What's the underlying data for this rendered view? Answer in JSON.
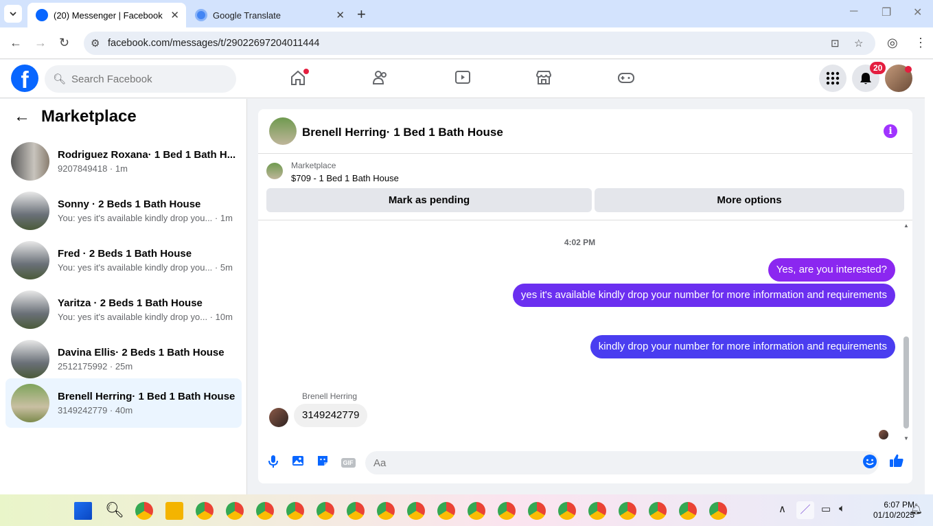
{
  "browser": {
    "tabs": [
      {
        "title": "(20) Messenger | Facebook",
        "close": "✕"
      },
      {
        "title": "Google Translate",
        "close": "✕"
      }
    ],
    "new_tab": "+",
    "url": "facebook.com/messages/t/29022697204011444",
    "window": {
      "minimize": "─",
      "maximize": "❐",
      "close": "✕"
    }
  },
  "facebook": {
    "logo": "f",
    "search_placeholder": "Search Facebook",
    "notifications_count": "20",
    "colors": {
      "brand": "#0866ff",
      "outgoing": "#4a3df0",
      "incoming": "#f0f0f0",
      "badge": "#e41e3f",
      "selected": "#ebf5ff",
      "info": "#a033ff"
    }
  },
  "sidebar": {
    "title": "Marketplace",
    "conversations": [
      {
        "name": "Rodriguez Roxana· 1 Bed 1 Bath H...",
        "preview": "9207849418 · 1m"
      },
      {
        "name": "Sonny · 2 Beds 1 Bath House",
        "preview": "You: yes it's available kindly drop you... · 1m"
      },
      {
        "name": "Fred · 2 Beds 1 Bath House",
        "preview": "You: yes it's available kindly drop you... · 5m"
      },
      {
        "name": "Yaritza · 2 Beds 1 Bath House",
        "preview": "You: yes it's available kindly drop yo... · 10m"
      },
      {
        "name": "Davina Ellis· 2 Beds 1 Bath House",
        "preview": "2512175992 · 25m"
      },
      {
        "name": "Brenell Herring· 1 Bed 1 Bath House",
        "preview": "3149242779 · 40m"
      }
    ]
  },
  "chat": {
    "title": "Brenell Herring· 1 Bed 1 Bath House",
    "info_icon": "i",
    "marketplace_label": "Marketplace",
    "listing": "$709 - 1 Bed 1 Bath House",
    "mark_pending": "Mark as pending",
    "more_options": "More options",
    "timestamp": "4:02 PM",
    "outgoing": [
      "Yes, are you interested?",
      "yes it's available kindly drop your number for more information and requirements",
      "kindly drop your number for more information and requirements"
    ],
    "incoming_sender": "Brenell Herring",
    "incoming_message": "3149242779",
    "composer_placeholder": "Aa",
    "gif_label": "GIF"
  },
  "taskbar": {
    "time": "6:07 PM",
    "date": "01/10/2025"
  }
}
